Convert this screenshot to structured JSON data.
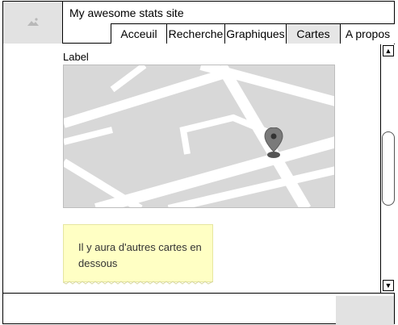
{
  "header": {
    "logo_icon": "image-placeholder-icon",
    "site_title": "My awesome stats site"
  },
  "nav": {
    "tabs": [
      {
        "label": "Acceuil",
        "active": false
      },
      {
        "label": "Recherche",
        "active": false
      },
      {
        "label": "Graphiques",
        "active": false
      },
      {
        "label": "Cartes",
        "active": true
      },
      {
        "label": "A propos",
        "active": false
      }
    ]
  },
  "main": {
    "label": "Label",
    "map_icon": "map-pin-icon",
    "note_text": "Il y aura d'autres cartes en dessous"
  },
  "scrollbar": {
    "up_icon": "▲",
    "down_icon": "▼"
  },
  "colors": {
    "map_bg": "#d8d8d8",
    "road": "#ffffff",
    "note_bg": "#ffffc4",
    "active_tab": "#e6e6e6",
    "placeholder": "#e2e2e2"
  }
}
